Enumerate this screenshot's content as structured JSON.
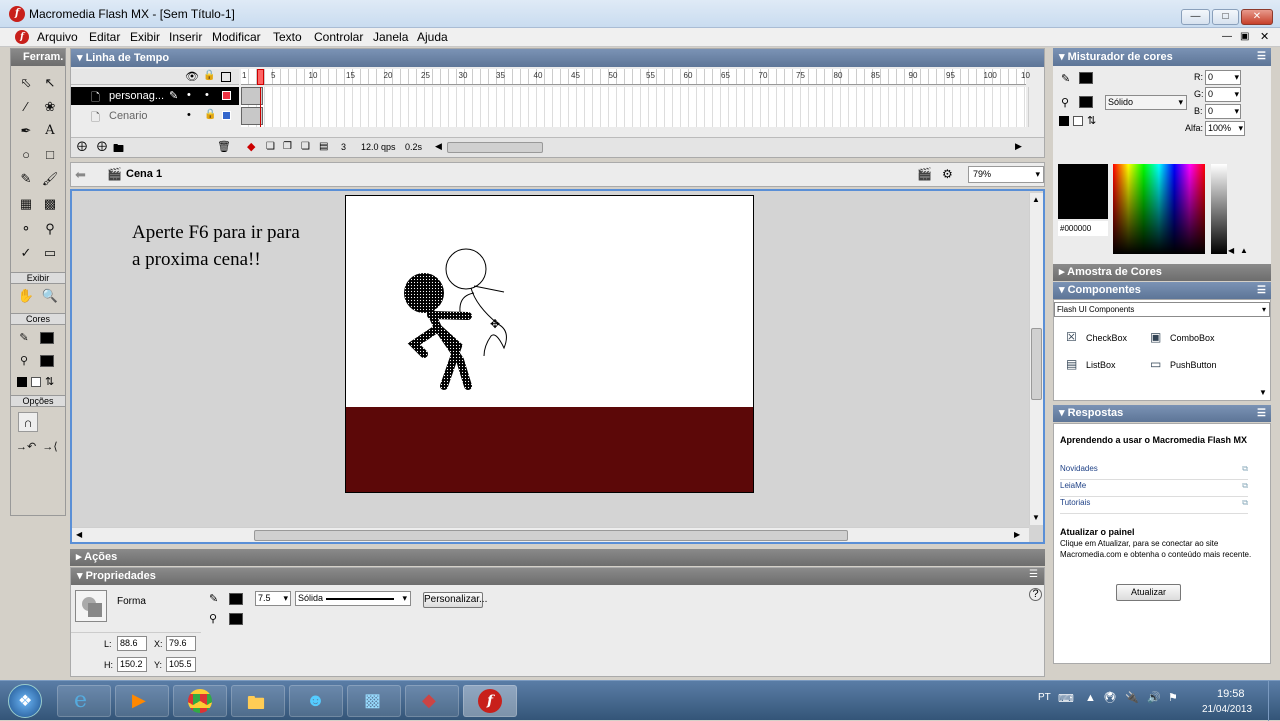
{
  "app": {
    "title": "Macromedia Flash MX - [Sem Título-1]"
  },
  "menu": [
    "Arquivo",
    "Editar",
    "Exibir",
    "Inserir",
    "Modificar",
    "Texto",
    "Controlar",
    "Janela",
    "Ajuda"
  ],
  "toolbox": {
    "header": "Ferram.",
    "view_label": "Exibir",
    "colors_label": "Cores",
    "options_label": "Opções"
  },
  "timeline": {
    "header": "Linha de Tempo",
    "frame_numbers": [
      "1",
      "5",
      "10",
      "15",
      "20",
      "25",
      "30",
      "35",
      "40",
      "45",
      "50",
      "55",
      "60",
      "65",
      "70",
      "75",
      "80",
      "85",
      "90",
      "95",
      "100",
      "10"
    ],
    "layers": [
      {
        "name": "personag..."
      },
      {
        "name": "Cenario"
      }
    ],
    "current_frame": "3",
    "fps": "12.0 qps",
    "time": "0.2s"
  },
  "stage": {
    "scene": "Cena 1",
    "zoom": "79%",
    "instruction_text": "Aperte F6 para ir para a proxima cena!!",
    "colors": {
      "stage": "#ffffff",
      "ground": "#5c0808",
      "workspace": "#d4d4d4"
    }
  },
  "actions": {
    "header": "Ações"
  },
  "properties": {
    "header": "Propriedades",
    "type": "Forma",
    "stroke_size": "7.5",
    "stroke_style": "Sólida",
    "customize_label": "Personalizar...",
    "L_label": "L:",
    "L": "88.6",
    "X_label": "X:",
    "X": "79.6",
    "H_label": "H:",
    "H": "150.2",
    "Y_label": "Y:",
    "Y": "105.5"
  },
  "color_mixer": {
    "header": "Misturador de cores",
    "R_label": "R:",
    "R": "0",
    "G_label": "G:",
    "G": "0",
    "B_label": "B:",
    "B": "0",
    "alpha_label": "Alfa:",
    "alpha": "100%",
    "fill_type": "Sólido",
    "hex": "#000000"
  },
  "swatches": {
    "header": "Amostra de Cores"
  },
  "components": {
    "header": "Componentes",
    "set": "Flash UI Components",
    "items": [
      "CheckBox",
      "ComboBox",
      "ListBox",
      "PushButton"
    ]
  },
  "answers": {
    "header": "Respostas",
    "title": "Aprendendo a usar o Macromedia Flash MX",
    "links": [
      "Novidades",
      "LeiaMe",
      "Tutoriais"
    ],
    "update_title": "Atualizar o painel",
    "update_text": "Clique em Atualizar, para se conectar ao site Macromedia.com e obtenha o conteúdo mais recente.",
    "update_button": "Atualizar"
  },
  "taskbar": {
    "lang": "PT",
    "time": "19:58",
    "date": "21/04/2013"
  }
}
